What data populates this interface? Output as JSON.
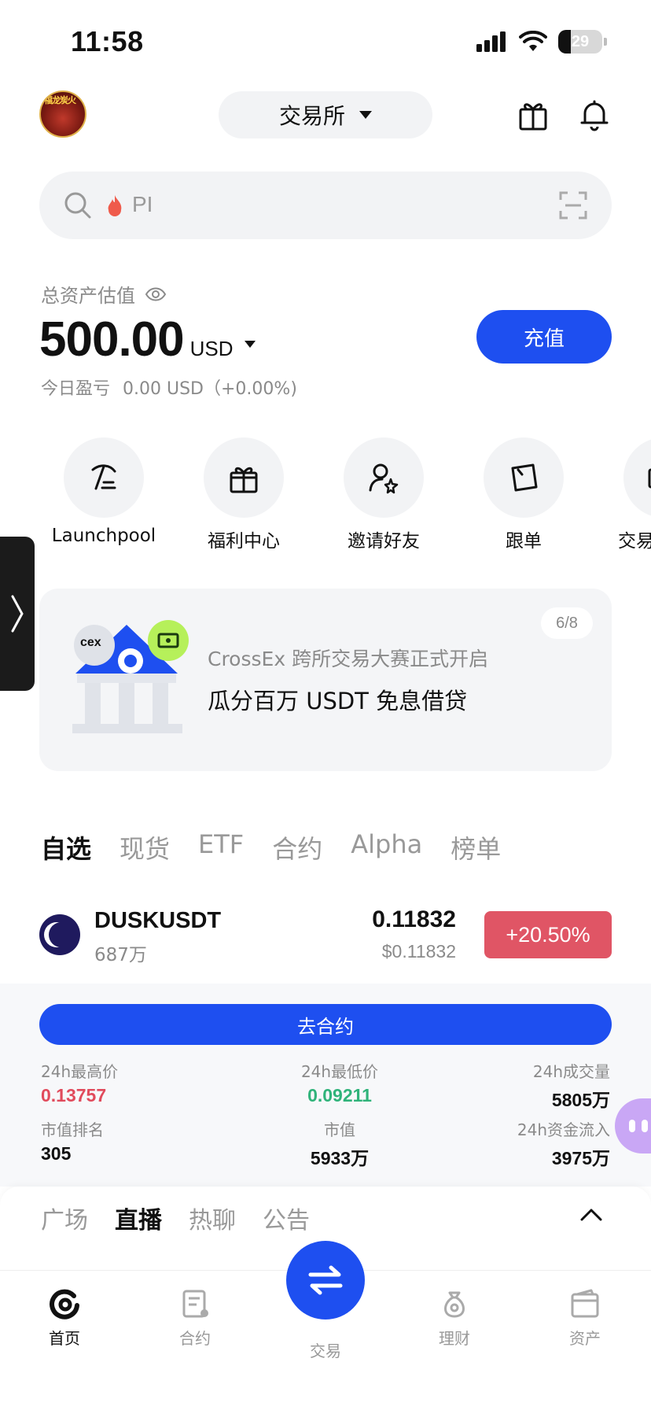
{
  "status_bar": {
    "time": "11:58",
    "battery": "29",
    "battery_level": 0.29
  },
  "header": {
    "exchange_label": "交易所",
    "avatar_text": "福龙炭火"
  },
  "search": {
    "placeholder": "PI"
  },
  "assets": {
    "label": "总资产估值",
    "amount": "500.00",
    "currency": "USD",
    "pnl_label": "今日盈亏",
    "pnl_value": "0.00 USD（+0.00%)",
    "deposit_button": "充值"
  },
  "quick_actions": [
    {
      "label": "Launchpool",
      "icon": "pickaxe-icon"
    },
    {
      "label": "福利中心",
      "icon": "gift-icon"
    },
    {
      "label": "邀请好友",
      "icon": "invite-user-icon"
    },
    {
      "label": "跟单",
      "icon": "copy-trade-card-icon"
    },
    {
      "label": "交易",
      "icon": "trade-icon"
    }
  ],
  "banner": {
    "counter": "6/8",
    "art_badge": "cex",
    "subtitle": "CrossEx 跨所交易大赛正式开启",
    "title": "瓜分百万 USDT 免息借贷"
  },
  "market_tabs": [
    "自选",
    "现货",
    "ETF",
    "合约",
    "Alpha",
    "榜单"
  ],
  "market_row": {
    "symbol": "DUSKUSDT",
    "volume": "687万",
    "price": "0.11832",
    "price_usd": "$0.11832",
    "change": "+20.50%"
  },
  "detail": {
    "button": "去合约",
    "stats": [
      {
        "label": "24h最高价",
        "value": "0.13757"
      },
      {
        "label": "24h最低价",
        "value": "0.09211"
      },
      {
        "label": "24h成交量",
        "value": "5805万"
      },
      {
        "label": "市值排名",
        "value": "305"
      },
      {
        "label": "市值",
        "value": "5933万"
      },
      {
        "label": "24h资金流入",
        "value": "3975万"
      }
    ]
  },
  "community_tabs": [
    "广场",
    "直播",
    "热聊",
    "公告"
  ],
  "bottom_nav": [
    {
      "label": "首页",
      "icon": "home-logo-icon"
    },
    {
      "label": "合约",
      "icon": "contract-icon"
    },
    {
      "label": "交易",
      "icon": "swap-icon"
    },
    {
      "label": "理财",
      "icon": "moneybag-icon"
    },
    {
      "label": "资产",
      "icon": "wallet-icon"
    }
  ],
  "colors": {
    "accent": "#1e4ff0",
    "up": "#e05565",
    "down": "#2fb37a"
  }
}
